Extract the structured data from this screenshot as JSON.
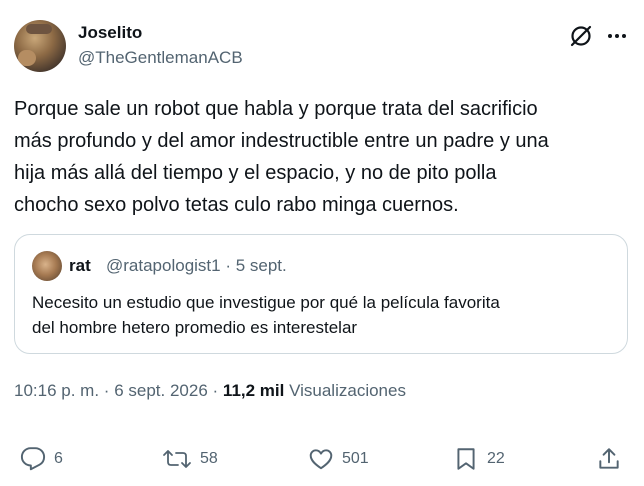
{
  "tweet": {
    "display_name": "Joselito",
    "handle": "@TheGentlemanACB",
    "text": "Porque sale un robot que habla y porque trata del sacrificio\nmás profundo y del amor indestructible entre un padre y una\nhija más allá del tiempo y el espacio, y no de pito polla\nchocho sexo polvo tetas culo rabo minga cuernos.",
    "time": "10:16 p. m.",
    "date": "6 sept. 2026",
    "views_count": "11,2 mil",
    "views_label": "Visualizaciones",
    "separator": "·"
  },
  "quote": {
    "display_name": "rat",
    "handle_date": "@ratapologist1 · 5 sept.",
    "text": "Necesito un estudio que investigue por qué la película favorita\ndel hombre hetero promedio es interestelar"
  },
  "actions": {
    "replies": "6",
    "reposts": "58",
    "likes": "501",
    "bookmarks": "22"
  },
  "icons": {
    "grok": "grok-icon",
    "more": "more-icon",
    "reply": "reply-icon",
    "repost": "repost-icon",
    "like": "heart-icon",
    "bookmark": "bookmark-icon",
    "share": "share-icon"
  },
  "colors": {
    "text": "#0f1419",
    "secondary": "#536471",
    "border": "#cfd9de"
  }
}
